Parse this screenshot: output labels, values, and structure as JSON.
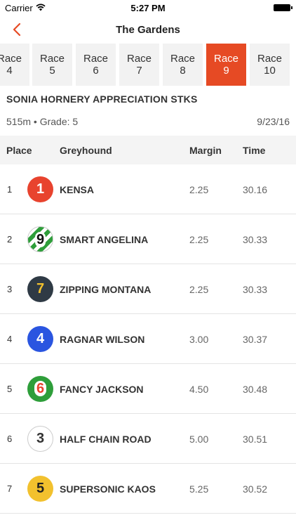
{
  "status": {
    "carrier": "Carrier",
    "time": "5:27 PM"
  },
  "nav": {
    "title": "The Gardens"
  },
  "tabs": [
    {
      "label": "Race\n4"
    },
    {
      "label": "Race\n5"
    },
    {
      "label": "Race\n6"
    },
    {
      "label": "Race\n7"
    },
    {
      "label": "Race\n8"
    },
    {
      "label": "Race\n9"
    },
    {
      "label": "Race\n10"
    }
  ],
  "active_tab": "Race 9",
  "race": {
    "name": "SONIA HORNERY APPRECIATION STKS",
    "meta": "515m • Grade: 5",
    "date": "9/23/16"
  },
  "table": {
    "headers": {
      "place": "Place",
      "greyhound": "Greyhound",
      "margin": "Margin",
      "time": "Time"
    },
    "rows": [
      {
        "place": "1",
        "box": "1",
        "name": "KENSA",
        "margin": "2.25",
        "time": "30.16"
      },
      {
        "place": "2",
        "box": "9",
        "name": "SMART ANGELINA",
        "margin": "2.25",
        "time": "30.33"
      },
      {
        "place": "3",
        "box": "7",
        "name": "ZIPPING MONTANA",
        "margin": "2.25",
        "time": "30.33"
      },
      {
        "place": "4",
        "box": "4",
        "name": "RAGNAR WILSON",
        "margin": "3.00",
        "time": "30.37"
      },
      {
        "place": "5",
        "box": "6",
        "name": "FANCY JACKSON",
        "margin": "4.50",
        "time": "30.48"
      },
      {
        "place": "6",
        "box": "3",
        "name": "HALF CHAIN ROAD",
        "margin": "5.00",
        "time": "30.51"
      },
      {
        "place": "7",
        "box": "5",
        "name": "SUPERSONIC KAOS",
        "margin": "5.25",
        "time": "30.52"
      }
    ]
  },
  "colors": {
    "accent": "#e64a24"
  }
}
